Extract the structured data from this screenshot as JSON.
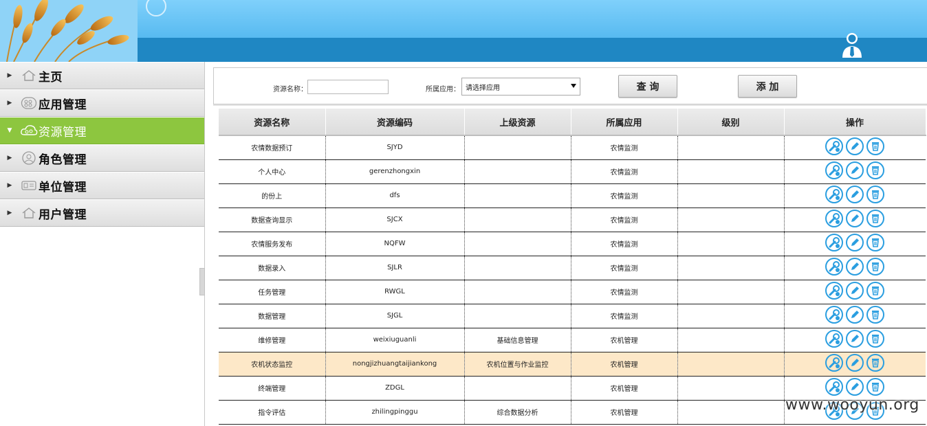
{
  "colors": {
    "header_sky": "#5bbff2",
    "header_band": "#1f87c3",
    "active_menu": "#8dc63f",
    "icon_blue": "#2a9ee0",
    "highlight_row": "#fde8c8"
  },
  "sidebar": {
    "items": [
      {
        "label": "主页",
        "icon": "home-icon",
        "active": false
      },
      {
        "label": "应用管理",
        "icon": "app-grid-icon",
        "active": false
      },
      {
        "label": "资源管理",
        "icon": "cloud-resource-icon",
        "active": true
      },
      {
        "label": "角色管理",
        "icon": "person-icon",
        "active": false
      },
      {
        "label": "单位管理",
        "icon": "building-icon",
        "active": false
      },
      {
        "label": "用户管理",
        "icon": "home-icon",
        "active": false
      }
    ]
  },
  "search": {
    "name_label": "资源名称：",
    "name_value": "",
    "app_label": "所属应用：",
    "app_selected": "请选择应用",
    "query_button": "查 询",
    "add_button": "添 加"
  },
  "table": {
    "columns": [
      "资源名称",
      "资源编码",
      "上级资源",
      "所属应用",
      "级别",
      "操作"
    ],
    "rows": [
      {
        "name": "农情数据预订",
        "code": "SJYD",
        "parent": "",
        "app": "农情监测",
        "level": ""
      },
      {
        "name": "个人中心",
        "code": "gerenzhongxin",
        "parent": "",
        "app": "农情监测",
        "level": ""
      },
      {
        "name": "的份上",
        "code": "dfs",
        "parent": "",
        "app": "农情监测",
        "level": ""
      },
      {
        "name": "数据查询显示",
        "code": "SJCX",
        "parent": "",
        "app": "农情监测",
        "level": ""
      },
      {
        "name": "农情服务发布",
        "code": "NQFW",
        "parent": "",
        "app": "农情监测",
        "level": ""
      },
      {
        "name": "数据录入",
        "code": "SJLR",
        "parent": "",
        "app": "农情监测",
        "level": ""
      },
      {
        "name": "任务管理",
        "code": "RWGL",
        "parent": "",
        "app": "农情监测",
        "level": ""
      },
      {
        "name": "数据管理",
        "code": "SJGL",
        "parent": "",
        "app": "农情监测",
        "level": ""
      },
      {
        "name": "维修管理",
        "code": "weixiuguanli",
        "parent": "基础信息管理",
        "app": "农机管理",
        "level": ""
      },
      {
        "name": "农机状态监控",
        "code": "nongjizhuangtaijiankong",
        "parent": "农机位置与作业监控",
        "app": "农机管理",
        "level": "",
        "highlight": true
      },
      {
        "name": "终端管理",
        "code": "ZDGL",
        "parent": "",
        "app": "农机管理",
        "level": ""
      },
      {
        "name": "指令评估",
        "code": "zhilingpinggu",
        "parent": "综合数据分析",
        "app": "农机管理",
        "level": ""
      }
    ],
    "row_actions": [
      "settings-wrench-icon",
      "edit-pencil-icon",
      "delete-trash-icon"
    ]
  },
  "watermark": "www.wooyun.org"
}
